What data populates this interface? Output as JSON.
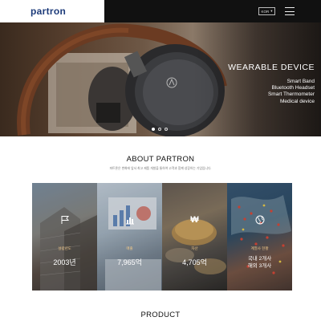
{
  "header": {
    "logo": "partron",
    "lang": "KOR"
  },
  "hero": {
    "title": "WEARABLE DEVICE",
    "items": [
      "Smart Band",
      "Bluetooth Headset",
      "Smart Thermometer",
      "Medical device"
    ]
  },
  "about": {
    "title": "ABOUT PARTRON",
    "subtitle": "파트론은 변화에 앞서 최고 제품 개발을 통하여 고객과 함께 성장하는 기업입니다.",
    "tiles": [
      {
        "label": "설립년도",
        "value": "2003년"
      },
      {
        "label": "매출",
        "value": "7,965억"
      },
      {
        "label": "자산",
        "value": "4,705억"
      },
      {
        "label": "계열사 현황",
        "line1": "국내 2개사",
        "line2": "해외 3개사"
      }
    ]
  },
  "product": {
    "title": "PRODUCT"
  },
  "colors": {
    "brand": "#1d3b7a",
    "header": "#111111",
    "tile_label": "#f2c98a"
  }
}
